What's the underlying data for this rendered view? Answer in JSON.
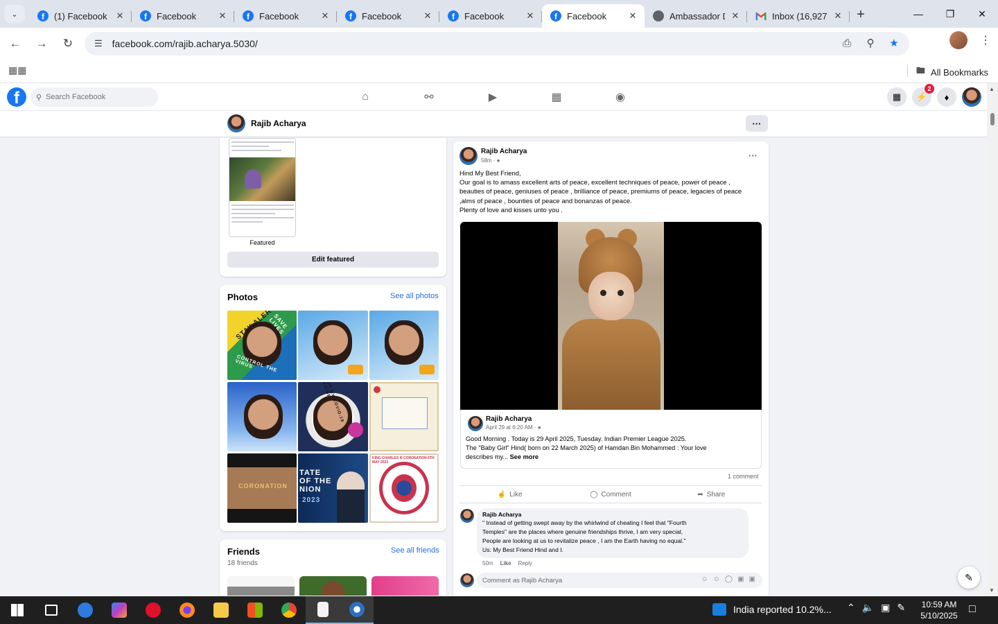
{
  "browser": {
    "tabs": [
      {
        "title": "(1) Facebook",
        "icon": "facebook-icon"
      },
      {
        "title": "Facebook",
        "icon": "facebook-icon"
      },
      {
        "title": "Facebook",
        "icon": "facebook-icon"
      },
      {
        "title": "Facebook",
        "icon": "facebook-icon"
      },
      {
        "title": "Facebook",
        "icon": "facebook-icon"
      },
      {
        "title": "Facebook",
        "icon": "facebook-icon",
        "active": true
      },
      {
        "title": "Ambassador D",
        "icon": "globe-icon"
      },
      {
        "title": "Inbox (16,927)",
        "icon": "gmail-icon"
      }
    ],
    "url": "facebook.com/rajib.acharya.5030/",
    "bookmarks_label": "All Bookmarks"
  },
  "fb": {
    "search_placeholder": "Search Facebook",
    "messenger_badge": "2",
    "profile_name": "Rajib Acharya",
    "more_label": "···"
  },
  "left": {
    "featured_label": "Featured",
    "edit_featured": "Edit featured",
    "photos_title": "Photos",
    "see_all_photos": "See all photos",
    "photo_texts": [
      "STAY ALERT",
      "SAVE LIVES",
      "CONTROL THE VIRUS",
      "I GOT MY COVID-19 VACCINE",
      "CORONATION",
      "TATE OF THE NION",
      "2023",
      "KING CHARLES III CORONATION 6TH MAY 2023"
    ],
    "friends_title": "Friends",
    "see_all_friends": "See all friends",
    "friends_count": "18 friends"
  },
  "post": {
    "author": "Rajib Acharya",
    "time": "58m · ",
    "lines": [
      "Hind My Best Friend,",
      "Our goal is to amass excellent arts of peace, excellent techniques of peace, power of peace ,",
      "beauties of peace, geniuses of peace , brilliance of peace, premiums of peace, legacies of peace",
      ",alms of peace ,  bounties of peace  and bonanzas of peace.",
      "Plenty of love and kisses unto you ."
    ],
    "shared": {
      "author": "Rajib Acharya",
      "time": "April 29 at 6:20 AM · ",
      "line1": "Good Morning . Today is 29 April 2025, Tuesday. Indian Premier League 2025.",
      "line2": "The \"Baby Girl\" Hind( born on 22 March 2025) of Hamdan Bin Mohammed : Your love",
      "line3": "describes my...",
      "see_more": "See more"
    },
    "comment_count": "1 comment",
    "like_label": "Like",
    "comment_label": "Comment",
    "share_label": "Share",
    "comment": {
      "author": "Rajib Acharya",
      "lines": [
        "\" Instead of getting swept away by the whirlwind of cheating I feel that \"Fourth",
        "Temples\" are the places where genuine friendships thrive, I am very special,",
        "People are looking at us to revitalize peace , I am the Earth having no equal.\"",
        "Us: My Best Friend Hind and I."
      ],
      "time": "50m",
      "like": "Like",
      "reply": "Reply"
    },
    "write_placeholder": "Comment as Rajib Acharya"
  },
  "taskbar": {
    "news": "India reported 10.2%...",
    "time": "10:59 AM",
    "date": "5/10/2025"
  }
}
